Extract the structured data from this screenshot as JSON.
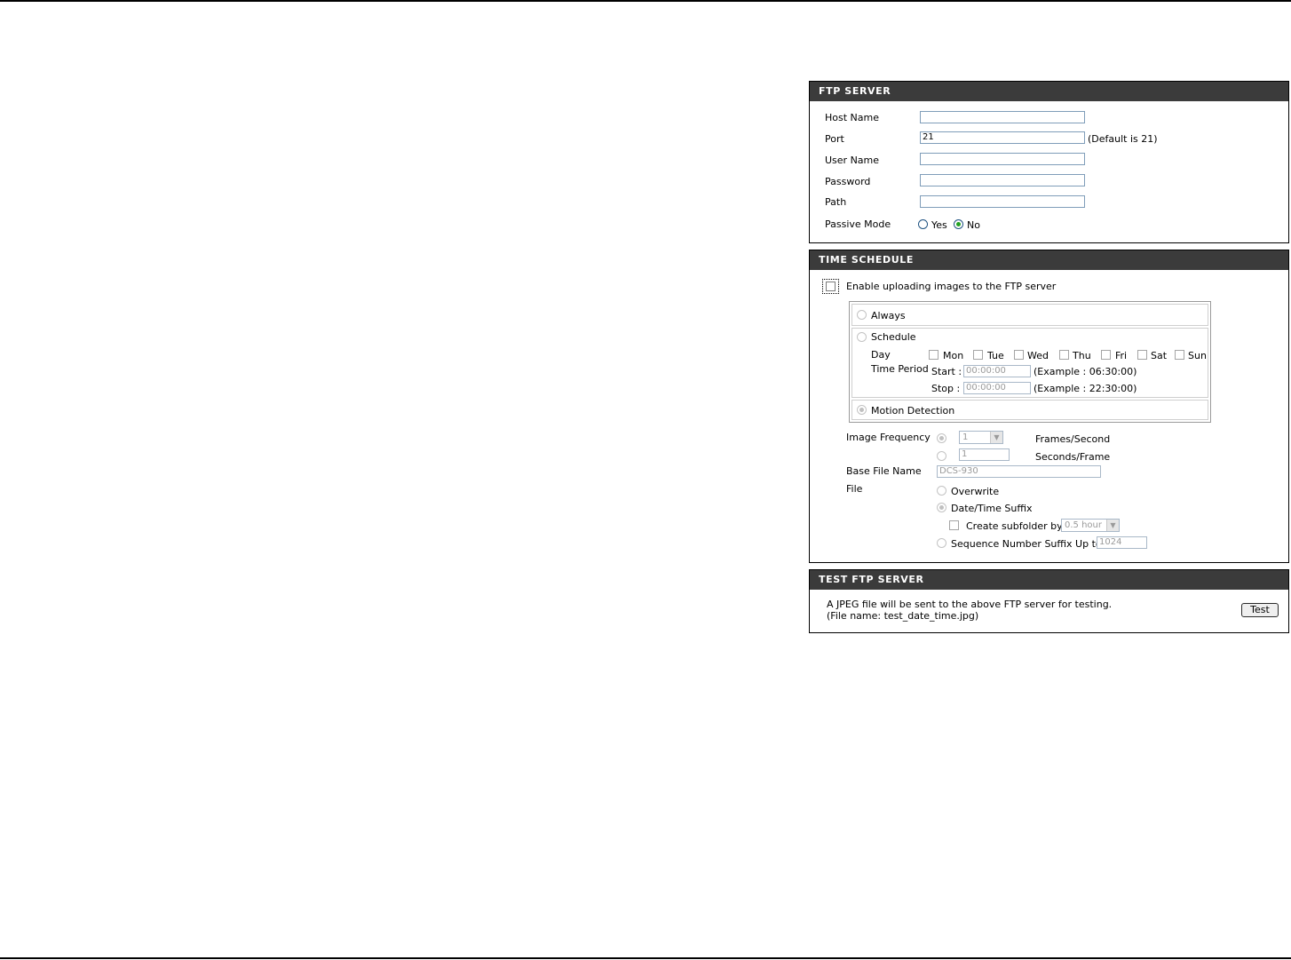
{
  "ftp_server": {
    "header": "FTP SERVER",
    "host_name_label": "Host Name",
    "host_name_value": "",
    "port_label": "Port",
    "port_value": "21",
    "port_hint": "(Default is 21)",
    "user_name_label": "User Name",
    "user_name_value": "",
    "password_label": "Password",
    "password_value": "",
    "path_label": "Path",
    "path_value": "",
    "passive_mode_label": "Passive Mode",
    "passive_yes": "Yes",
    "passive_no": "No",
    "passive_selected": "No"
  },
  "time_schedule": {
    "header": "TIME SCHEDULE",
    "enable_label": "Enable uploading images to the FTP server",
    "enable_checked": false,
    "always_label": "Always",
    "schedule_label": "Schedule",
    "day_label": "Day",
    "days": [
      "Mon",
      "Tue",
      "Wed",
      "Thu",
      "Fri",
      "Sat",
      "Sun"
    ],
    "time_period_label": "Time Period",
    "start_label": "Start :",
    "start_value": "00:00:00",
    "start_example": "(Example : 06:30:00)",
    "stop_label": "Stop :",
    "stop_value": "00:00:00",
    "stop_example": "(Example : 22:30:00)",
    "motion_label": "Motion Detection",
    "selected_mode": "Motion Detection",
    "image_frequency_label": "Image Frequency",
    "frames_value": "1",
    "frames_unit": "Frames/Second",
    "seconds_value": "1",
    "seconds_unit": "Seconds/Frame",
    "base_file_name_label": "Base File Name",
    "base_file_name_value": "DCS-930",
    "file_label": "File",
    "overwrite_label": "Overwrite",
    "datetime_suffix_label": "Date/Time Suffix",
    "create_subfolder_label": "Create subfolder by",
    "subfolder_value": "0.5 hour",
    "sequence_label": "Sequence Number Suffix Up to",
    "sequence_value": "1024",
    "file_selected": "Date/Time Suffix"
  },
  "test_ftp": {
    "header": "TEST FTP SERVER",
    "line1": "A JPEG file will be sent to the above FTP server for testing.",
    "line2": "(File name: test_date_time.jpg)",
    "button_label": "Test"
  },
  "colors": {
    "panel_header_bg": "#3b3b3b",
    "radio_selected": "#21a121",
    "input_border": "#7f9db9"
  }
}
